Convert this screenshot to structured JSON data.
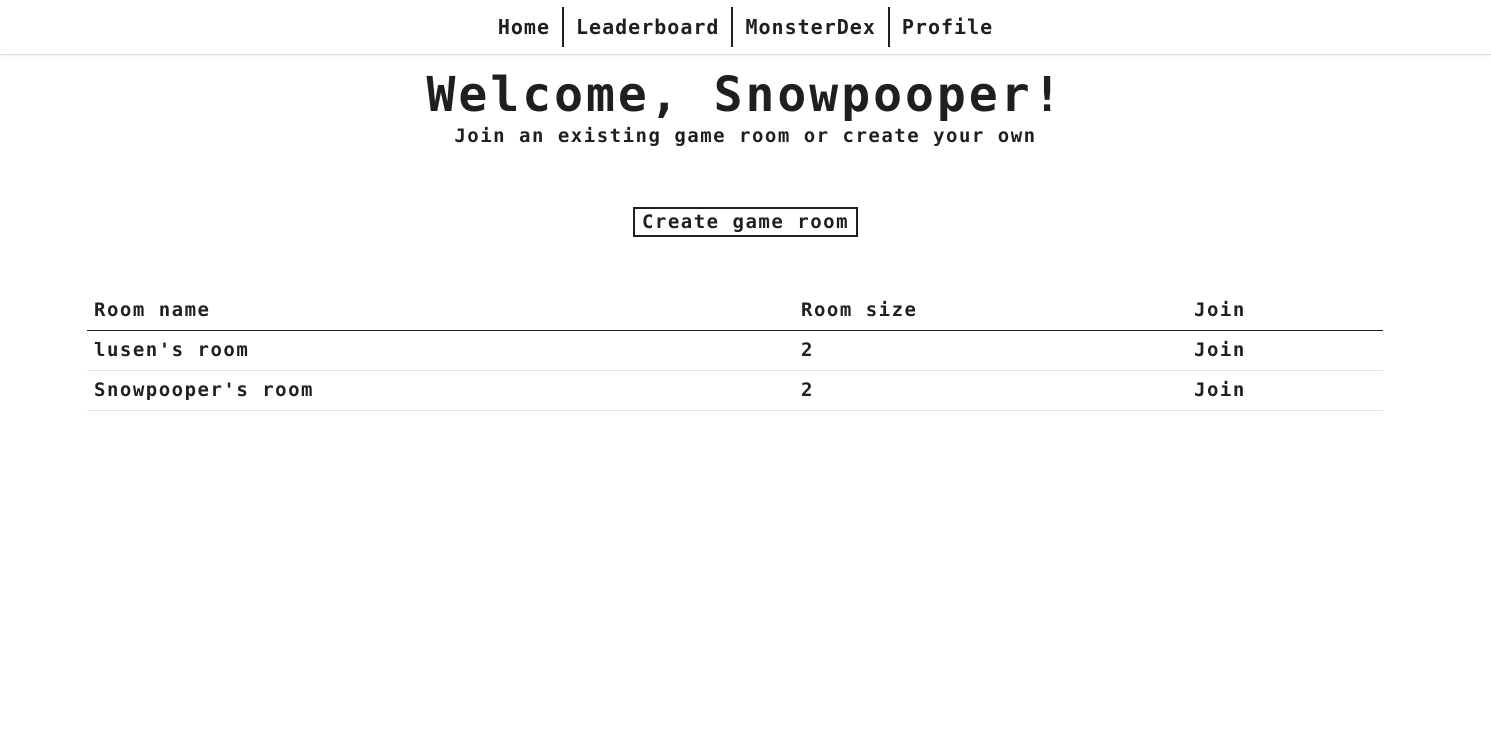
{
  "nav": {
    "items": [
      {
        "label": "Home"
      },
      {
        "label": "Leaderboard"
      },
      {
        "label": "MonsterDex"
      },
      {
        "label": "Profile"
      }
    ]
  },
  "hero": {
    "title": "Welcome, Snowpooper!",
    "subtitle": "Join an existing game room or create your own"
  },
  "create_button": {
    "label": "Create game room"
  },
  "table": {
    "headers": [
      "Room name",
      "Room size",
      "Join"
    ],
    "rows": [
      {
        "name": "lusen's room",
        "size": "2",
        "join": "Join"
      },
      {
        "name": "Snowpooper's room",
        "size": "2",
        "join": "Join"
      }
    ]
  }
}
